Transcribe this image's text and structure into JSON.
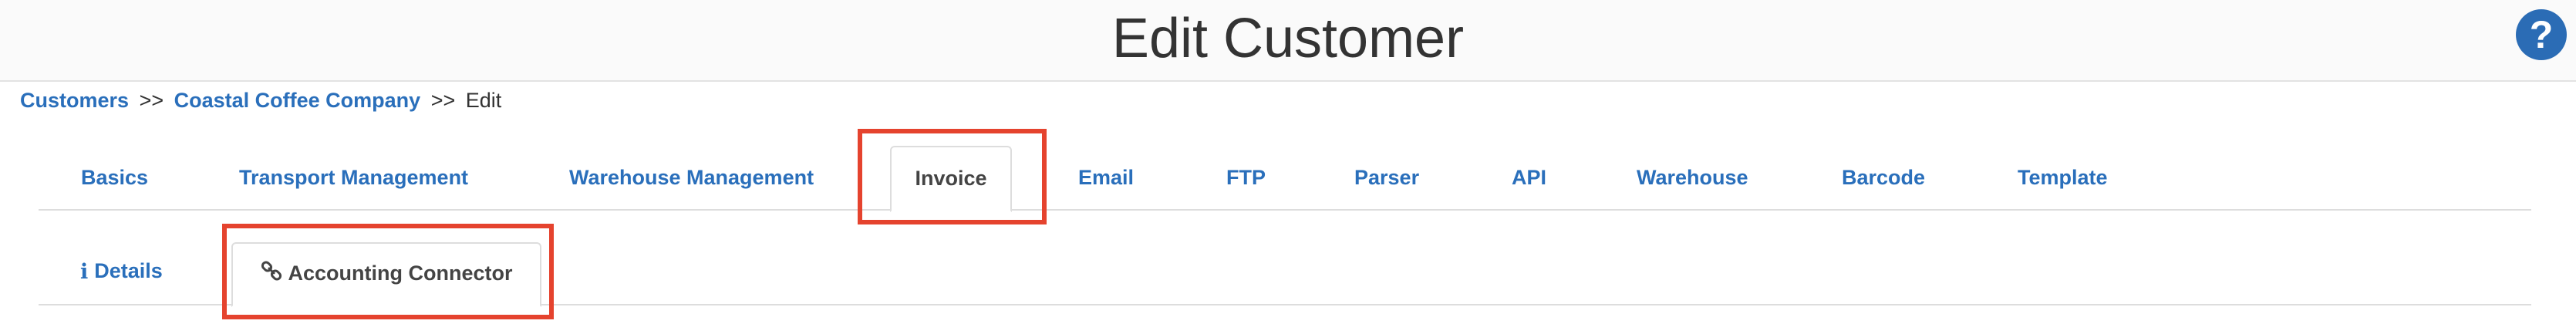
{
  "page": {
    "title": "Edit Customer",
    "help_icon": "question-circle-icon",
    "help_glyph": "?"
  },
  "breadcrumb": {
    "items": [
      "Customers",
      "Coastal Coffee Company"
    ],
    "separator": ">>",
    "current": "Edit"
  },
  "main_tabs": [
    {
      "label": "Basics",
      "active": false
    },
    {
      "label": "Transport Management",
      "active": false
    },
    {
      "label": "Warehouse Management",
      "active": false
    },
    {
      "label": "Invoice",
      "active": true
    },
    {
      "label": "Email",
      "active": false
    },
    {
      "label": "FTP",
      "active": false
    },
    {
      "label": "Parser",
      "active": false
    },
    {
      "label": "API",
      "active": false
    },
    {
      "label": "Warehouse",
      "active": false
    },
    {
      "label": "Barcode",
      "active": false
    },
    {
      "label": "Template",
      "active": false
    }
  ],
  "sub_tabs": [
    {
      "label": "Details",
      "icon": "info-icon",
      "icon_glyph": "ℹ",
      "active": false
    },
    {
      "label": "Accounting Connector",
      "icon": "link-icon",
      "active": true
    }
  ],
  "colors": {
    "link": "#2a6fbb",
    "highlight": "#e5432e",
    "help_bg": "#2b6cb5"
  }
}
